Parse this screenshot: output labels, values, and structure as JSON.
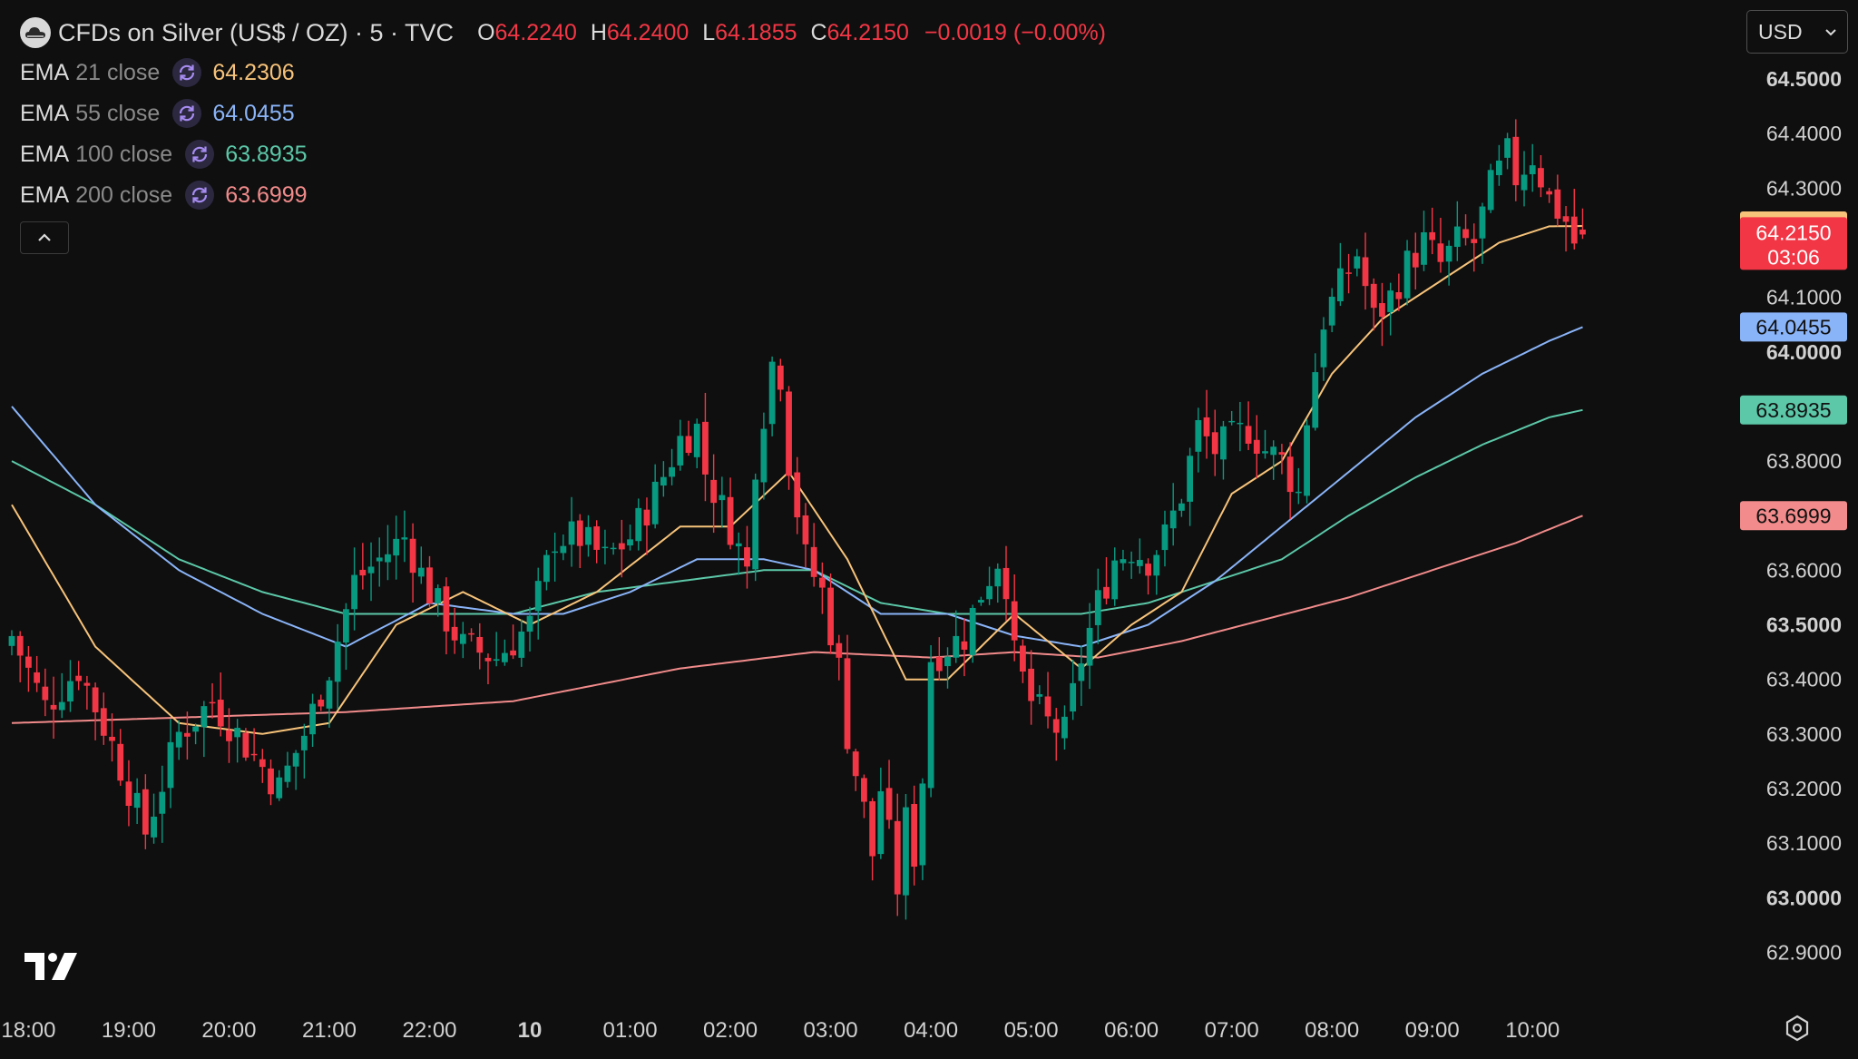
{
  "header": {
    "symbol_title": "CFDs on Silver (US$ / OZ) · 5 · TVC",
    "ohlc": {
      "open_label": "O",
      "open": "64.2240",
      "high_label": "H",
      "high": "64.2400",
      "low_label": "L",
      "low": "64.1855",
      "close_label": "C",
      "close": "64.2150",
      "change": "−0.0019 (−0.00%)"
    }
  },
  "indicators": [
    {
      "name": "EMA",
      "params": "21 close",
      "value": "64.2306",
      "color": "#f7c37a"
    },
    {
      "name": "EMA",
      "params": "55 close",
      "value": "64.0455",
      "color": "#8ab4f8"
    },
    {
      "name": "EMA",
      "params": "100 close",
      "value": "63.8935",
      "color": "#5cc8a8"
    },
    {
      "name": "EMA",
      "params": "200 close",
      "value": "63.6999",
      "color": "#f28b8b"
    }
  ],
  "currency_select": {
    "value": "USD"
  },
  "colors": {
    "background": "#0f0f0f",
    "up": "#089981",
    "down": "#f23645",
    "axis_text": "#d1d1d1",
    "sync_icon": "#a68cf0"
  },
  "icons": {
    "symbol_logo": "cloud-icon",
    "indicator_sync": "refresh-icon",
    "collapse": "chevron-up-icon",
    "currency_dropdown": "chevron-down-icon",
    "brand": "tradingview-logo",
    "settings": "gear-icon"
  },
  "chart_data": {
    "type": "candlestick",
    "title": "CFDs on Silver (US$ / OZ) · 5 · TVC",
    "y_axis": {
      "ylim": [
        62.85,
        64.56
      ],
      "ticks": [
        "62.9000",
        "63.0000",
        "63.1000",
        "63.2000",
        "63.3000",
        "63.4000",
        "63.5000",
        "63.6000",
        "63.7000",
        "63.8000",
        "63.9000",
        "64.0000",
        "64.1000",
        "64.2000",
        "64.3000",
        "64.4000",
        "64.5000"
      ],
      "shown_tick_labels": [
        "62.9000",
        "63.0000",
        "63.1000",
        "63.2000",
        "63.3000",
        "63.4000",
        "63.5000",
        "63.6000",
        "63.8000",
        "64.0000",
        "64.1000",
        "64.3000",
        "64.4000",
        "64.5000"
      ],
      "bold_ticks": [
        "63.0000",
        "63.5000",
        "64.0000",
        "64.5000"
      ]
    },
    "x_axis": {
      "ticks": [
        {
          "label": "18:00",
          "t": 2
        },
        {
          "label": "19:00",
          "t": 14
        },
        {
          "label": "20:00",
          "t": 26
        },
        {
          "label": "21:00",
          "t": 38
        },
        {
          "label": "22:00",
          "t": 50
        },
        {
          "label": "10",
          "t": 62,
          "bold": true
        },
        {
          "label": "01:00",
          "t": 74
        },
        {
          "label": "02:00",
          "t": 86
        },
        {
          "label": "03:00",
          "t": 98
        },
        {
          "label": "04:00",
          "t": 110
        },
        {
          "label": "05:00",
          "t": 122
        },
        {
          "label": "06:00",
          "t": 134
        },
        {
          "label": "07:00",
          "t": 146
        },
        {
          "label": "08:00",
          "t": 158
        },
        {
          "label": "09:00",
          "t": 170
        },
        {
          "label": "10:00",
          "t": 182
        }
      ]
    },
    "last_price": {
      "value": "64.2150",
      "countdown": "03:06"
    },
    "price_labels": [
      {
        "value": "64.2306",
        "series": 0
      },
      {
        "value": "64.0455",
        "series": 1
      },
      {
        "value": "63.8935",
        "series": 2
      },
      {
        "value": "63.6999",
        "series": 3
      }
    ],
    "close_keypoints": [
      [
        0,
        63.48
      ],
      [
        4,
        63.35
      ],
      [
        8,
        63.42
      ],
      [
        12,
        63.28
      ],
      [
        16,
        63.12
      ],
      [
        20,
        63.3
      ],
      [
        24,
        63.36
      ],
      [
        28,
        63.28
      ],
      [
        32,
        63.2
      ],
      [
        35,
        63.3
      ],
      [
        38,
        63.42
      ],
      [
        41,
        63.58
      ],
      [
        44,
        63.62
      ],
      [
        47,
        63.66
      ],
      [
        50,
        63.56
      ],
      [
        54,
        63.46
      ],
      [
        58,
        63.44
      ],
      [
        62,
        63.5
      ],
      [
        65,
        63.66
      ],
      [
        68,
        63.66
      ],
      [
        71,
        63.62
      ],
      [
        74,
        63.66
      ],
      [
        77,
        63.74
      ],
      [
        80,
        63.84
      ],
      [
        82,
        63.86
      ],
      [
        83,
        63.78
      ],
      [
        86,
        63.68
      ],
      [
        88,
        63.6
      ],
      [
        89,
        63.8
      ],
      [
        91,
        63.98
      ],
      [
        92,
        63.96
      ],
      [
        93,
        63.8
      ],
      [
        95,
        63.62
      ],
      [
        97,
        63.56
      ],
      [
        99,
        63.42
      ],
      [
        100,
        63.3
      ],
      [
        102,
        63.16
      ],
      [
        103,
        63.08
      ],
      [
        104,
        63.2
      ],
      [
        106,
        63.02
      ],
      [
        107,
        63.14
      ],
      [
        108,
        63.08
      ],
      [
        109,
        63.22
      ],
      [
        110,
        63.44
      ],
      [
        112,
        63.46
      ],
      [
        114,
        63.48
      ],
      [
        116,
        63.56
      ],
      [
        118,
        63.62
      ],
      [
        119,
        63.58
      ],
      [
        120,
        63.44
      ],
      [
        122,
        63.36
      ],
      [
        124,
        63.32
      ],
      [
        126,
        63.3
      ],
      [
        128,
        63.44
      ],
      [
        130,
        63.54
      ],
      [
        132,
        63.62
      ],
      [
        134,
        63.64
      ],
      [
        136,
        63.62
      ],
      [
        138,
        63.66
      ],
      [
        140,
        63.74
      ],
      [
        142,
        63.86
      ],
      [
        144,
        63.82
      ],
      [
        146,
        63.84
      ],
      [
        148,
        63.86
      ],
      [
        150,
        63.82
      ],
      [
        152,
        63.8
      ],
      [
        154,
        63.74
      ],
      [
        155,
        63.88
      ],
      [
        157,
        64.06
      ],
      [
        159,
        64.12
      ],
      [
        161,
        64.18
      ],
      [
        163,
        64.06
      ],
      [
        165,
        64.1
      ],
      [
        167,
        64.16
      ],
      [
        169,
        64.2
      ],
      [
        171,
        64.16
      ],
      [
        173,
        64.2
      ],
      [
        175,
        64.2
      ],
      [
        177,
        64.3
      ],
      [
        179,
        64.36
      ],
      [
        180,
        64.32
      ],
      [
        182,
        64.36
      ],
      [
        184,
        64.28
      ],
      [
        186,
        64.24
      ],
      [
        187,
        64.2
      ],
      [
        188,
        64.215
      ]
    ],
    "ema_21": [
      [
        0,
        63.72
      ],
      [
        10,
        63.46
      ],
      [
        20,
        63.32
      ],
      [
        30,
        63.3
      ],
      [
        38,
        63.32
      ],
      [
        46,
        63.5
      ],
      [
        54,
        63.56
      ],
      [
        62,
        63.5
      ],
      [
        70,
        63.56
      ],
      [
        80,
        63.68
      ],
      [
        86,
        63.68
      ],
      [
        93,
        63.78
      ],
      [
        100,
        63.62
      ],
      [
        107,
        63.4
      ],
      [
        112,
        63.4
      ],
      [
        120,
        63.52
      ],
      [
        128,
        63.42
      ],
      [
        134,
        63.5
      ],
      [
        140,
        63.56
      ],
      [
        146,
        63.74
      ],
      [
        152,
        63.8
      ],
      [
        158,
        63.96
      ],
      [
        164,
        64.06
      ],
      [
        170,
        64.12
      ],
      [
        178,
        64.2
      ],
      [
        184,
        64.23
      ],
      [
        188,
        64.2306
      ]
    ],
    "ema_55": [
      [
        0,
        63.9
      ],
      [
        10,
        63.72
      ],
      [
        20,
        63.6
      ],
      [
        30,
        63.52
      ],
      [
        40,
        63.46
      ],
      [
        50,
        63.54
      ],
      [
        60,
        63.52
      ],
      [
        66,
        63.52
      ],
      [
        74,
        63.56
      ],
      [
        82,
        63.62
      ],
      [
        90,
        63.62
      ],
      [
        96,
        63.6
      ],
      [
        104,
        63.52
      ],
      [
        112,
        63.52
      ],
      [
        120,
        63.48
      ],
      [
        128,
        63.46
      ],
      [
        136,
        63.5
      ],
      [
        144,
        63.58
      ],
      [
        152,
        63.68
      ],
      [
        160,
        63.78
      ],
      [
        168,
        63.88
      ],
      [
        176,
        63.96
      ],
      [
        184,
        64.02
      ],
      [
        188,
        64.0455
      ]
    ],
    "ema_100": [
      [
        0,
        63.8
      ],
      [
        10,
        63.72
      ],
      [
        20,
        63.62
      ],
      [
        30,
        63.56
      ],
      [
        40,
        63.52
      ],
      [
        50,
        63.52
      ],
      [
        60,
        63.52
      ],
      [
        70,
        63.56
      ],
      [
        80,
        63.58
      ],
      [
        90,
        63.6
      ],
      [
        96,
        63.6
      ],
      [
        104,
        63.54
      ],
      [
        112,
        63.52
      ],
      [
        120,
        63.52
      ],
      [
        128,
        63.52
      ],
      [
        136,
        63.54
      ],
      [
        144,
        63.58
      ],
      [
        152,
        63.62
      ],
      [
        160,
        63.7
      ],
      [
        168,
        63.77
      ],
      [
        176,
        63.83
      ],
      [
        184,
        63.88
      ],
      [
        188,
        63.8935
      ]
    ],
    "ema_200": [
      [
        0,
        63.32
      ],
      [
        20,
        63.33
      ],
      [
        40,
        63.34
      ],
      [
        60,
        63.36
      ],
      [
        80,
        63.42
      ],
      [
        96,
        63.45
      ],
      [
        110,
        63.44
      ],
      [
        120,
        63.45
      ],
      [
        130,
        63.44
      ],
      [
        140,
        63.47
      ],
      [
        150,
        63.51
      ],
      [
        160,
        63.55
      ],
      [
        170,
        63.6
      ],
      [
        180,
        63.65
      ],
      [
        188,
        63.6999
      ]
    ]
  }
}
